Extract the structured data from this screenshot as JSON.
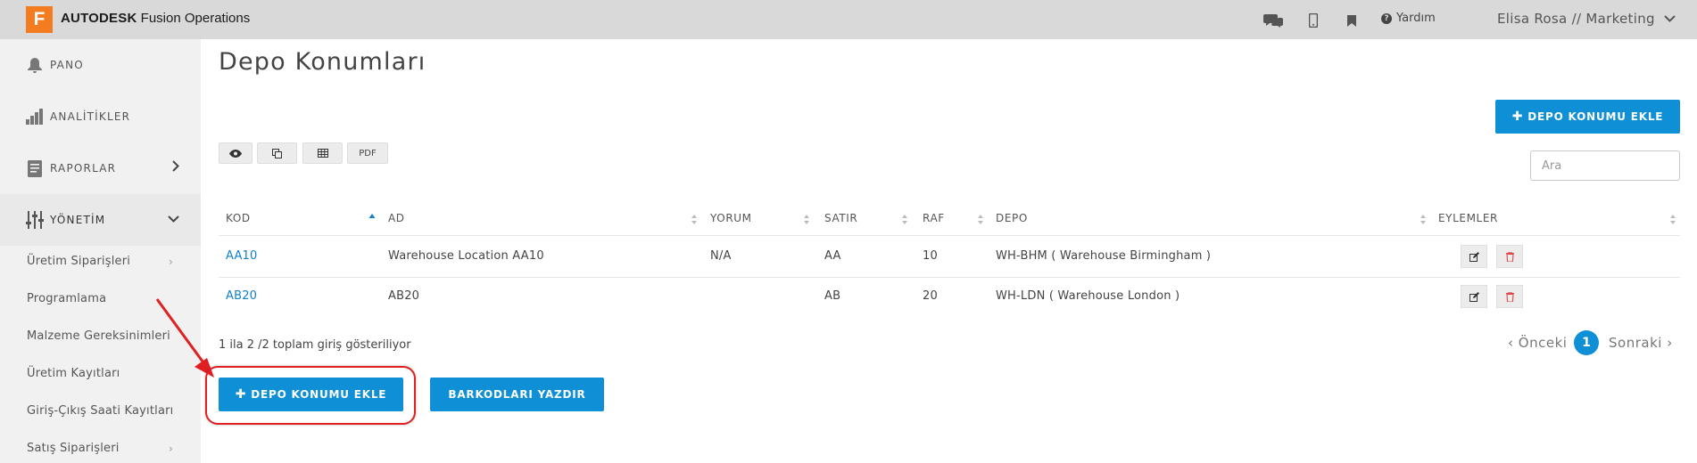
{
  "topbar": {
    "logo_letter": "F",
    "brand_bold": "AUTODESK",
    "brand_rest": "Fusion Operations",
    "icons": [
      "chat-icon",
      "mobile-icon",
      "bookmark-icon",
      "question-circle-icon"
    ],
    "help_label": "Yardım",
    "user_label": "Elisa Rosa // Marketing",
    "colors": {
      "bar": "#d9d9d9",
      "logo": "#f37c20"
    }
  },
  "sidebar": {
    "items": [
      {
        "label": "PANO",
        "icon": "bell-icon"
      },
      {
        "label": "ANALİTİKLER",
        "icon": "bar-chart-icon"
      },
      {
        "label": "RAPORLAR",
        "icon": "report-icon"
      },
      {
        "label": "YÖNETİM",
        "icon": "sliders-icon"
      }
    ],
    "sub_items": [
      {
        "label": "Üretim Siparişleri",
        "has_arrow": true
      },
      {
        "label": "Programlama",
        "has_arrow": false
      },
      {
        "label": "Malzeme Gereksinimleri",
        "has_arrow": false
      },
      {
        "label": "Üretim Kayıtları",
        "has_arrow": false
      },
      {
        "label": "Giriş-Çıkış Saati Kayıtları",
        "has_arrow": false
      },
      {
        "label": "Satış Siparişleri",
        "has_arrow": true
      }
    ]
  },
  "main": {
    "title": "Depo Konumları",
    "add_button_top": "DEPO KONUMU EKLE",
    "toolbar": {
      "pdf_label": "PDF",
      "icons": [
        "eye-icon",
        "copy-icon",
        "table-icon"
      ]
    },
    "search_placeholder": "Ara",
    "table": {
      "headers": [
        "KOD",
        "AD",
        "YORUM",
        "SATIR",
        "RAF",
        "DEPO",
        "EYLEMLER"
      ],
      "rows": [
        {
          "kod": "AA10",
          "ad": "Warehouse Location AA10",
          "yorum": "N/A",
          "satir": "AA",
          "raf": "10",
          "depo": "WH-BHM ( Warehouse Birmingham )"
        },
        {
          "kod": "AB20",
          "ad": "AB20",
          "yorum": "",
          "satir": "AB",
          "raf": "20",
          "depo": "WH-LDN ( Warehouse London )"
        }
      ]
    },
    "info": "1 ila 2 /2 toplam giriş gösteriliyor",
    "pager": {
      "prev": "Önceki",
      "current": "1",
      "next": "Sonraki"
    },
    "add_button_bottom": "DEPO KONUMU EKLE",
    "print_button": "BARKODLARI YAZDIR",
    "accent_color": "#0f8fd5",
    "annotation_color": "#e02020"
  }
}
